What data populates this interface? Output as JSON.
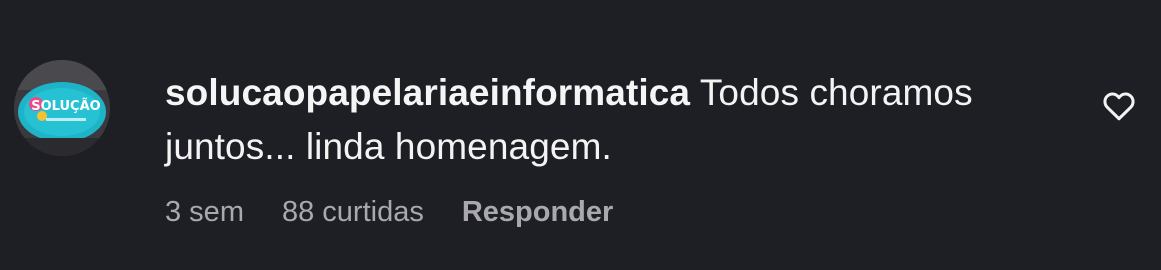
{
  "comment": {
    "username": "solucaopapelariaeinformatica",
    "text": "Todos choramos juntos... linda homenagem.",
    "time": "3 sem",
    "likes": "88 curtidas",
    "reply_label": "Responder",
    "avatar_text": "SOLUÇÃO",
    "like_icon": "heart-outline-icon"
  },
  "colors": {
    "background": "#1e1f24",
    "text": "#f3f3f3",
    "meta": "#a8a8ae",
    "avatar_accent": "#1fb3c7"
  }
}
